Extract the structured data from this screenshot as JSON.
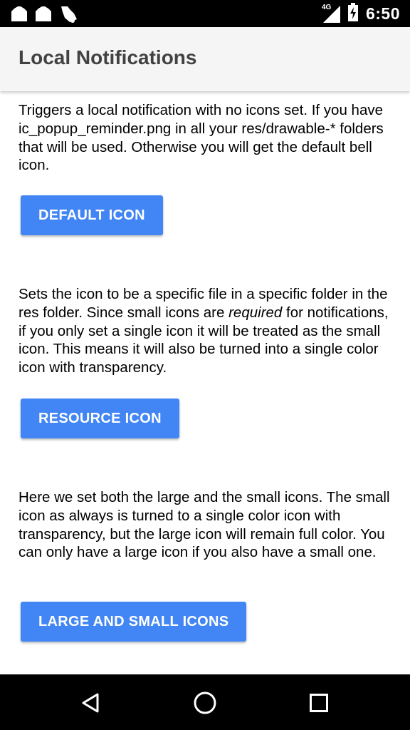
{
  "status_bar": {
    "time": "6:50",
    "network_label": "4G",
    "icons": [
      "notification-icon",
      "notification-icon",
      "bell-icon",
      "signal-icon",
      "battery-icon"
    ]
  },
  "app_bar": {
    "title": "Local Notifications"
  },
  "sections": [
    {
      "description": "Triggers a local notification with no icons set. If you have ic_popup_reminder.png in all your res/drawable-* folders that will be used. Otherwise you will get the default bell icon.",
      "button_label": "DEFAULT ICON"
    },
    {
      "description_before": "Sets the icon to be a specific file in a specific folder in the res folder. Since small icons are ",
      "description_emphasis": "required",
      "description_after": " for notifications, if you only set a single icon it will be treated as the small icon. This means it will also be turned into a single color icon with transparency.",
      "button_label": "RESOURCE ICON"
    },
    {
      "description": "Here we set both the large and the small icons. The small icon as always is turned to a single color icon with transparency, but the large icon will remain full color. You can only have a large icon if you also have a small one.",
      "button_label": "LARGE AND SMALL ICONS"
    }
  ],
  "nav_bar": {
    "icons": [
      "back-icon",
      "home-icon",
      "recents-icon"
    ]
  },
  "colors": {
    "button": "#4286f5",
    "app_bar": "#f5f5f5",
    "title": "#424242",
    "status_bar": "#000000"
  }
}
